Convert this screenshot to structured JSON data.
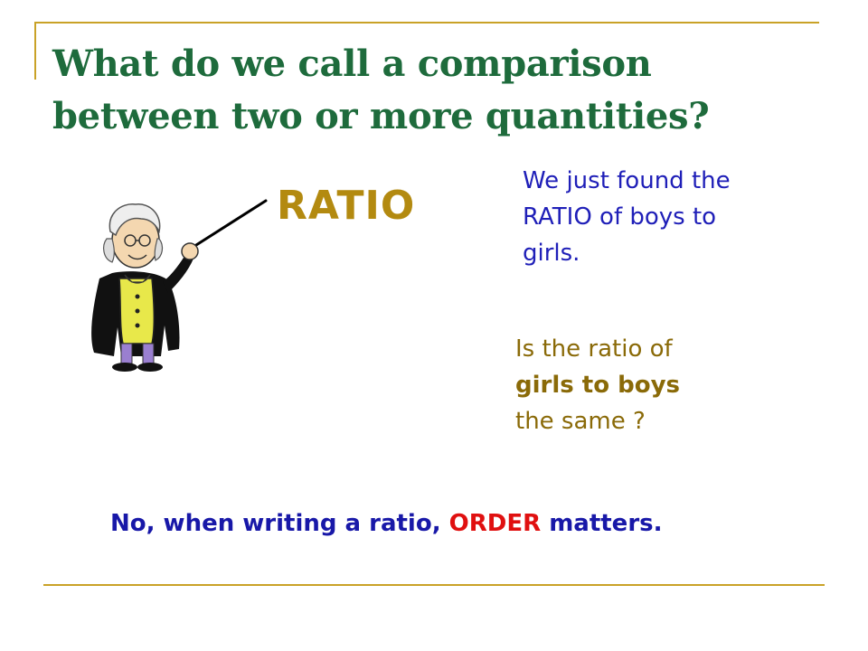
{
  "slide": {
    "title": "What do we call a comparison between two or more quantities?",
    "ratio_word": "RATIO",
    "note_blue": {
      "line1": "We just found the",
      "line2": "RATIO of boys to",
      "line3": "girls."
    },
    "note_gold": {
      "line1": "Is the ratio of",
      "line2": "girls to boys",
      "line3": "the same ?"
    },
    "answer": {
      "part1": "No, when writing a ratio, ",
      "part2": "ORDER",
      "part3": " matters."
    }
  },
  "colors": {
    "title": "#1e6b3c",
    "accent_rule": "#c9a227",
    "ratio_word": "#b38a10",
    "note_blue": "#1f1fb8",
    "note_gold": "#8a6a08",
    "answer": "#1818a8",
    "emphasis": "#e01010"
  },
  "icons": {
    "figure": "pointing-man-with-pointer-illustration"
  }
}
